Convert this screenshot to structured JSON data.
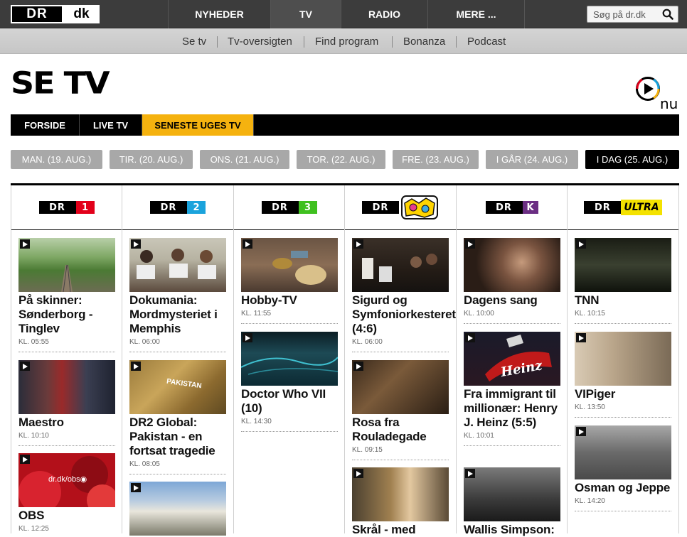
{
  "header": {
    "logo_dr": "DR",
    "logo_dk": "dk",
    "nav": [
      "NYHEDER",
      "TV",
      "RADIO",
      "MERE ..."
    ],
    "search_placeholder": "Søg på dr.dk"
  },
  "subnav": [
    "Se tv",
    "Tv-oversigten",
    "Find program",
    "Bonanza",
    "Podcast"
  ],
  "page": {
    "title": "SE TV",
    "nu_logo": "nu"
  },
  "tabs": [
    "FORSIDE",
    "LIVE TV",
    "SENESTE UGES TV"
  ],
  "days": [
    "MAN. (19. AUG.)",
    "TIR. (20. AUG.)",
    "ONS. (21. AUG.)",
    "TOR. (22. AUG.)",
    "FRE. (23. AUG.)",
    "I GÅR (24. AUG.)",
    "I DAG (25. AUG.)"
  ],
  "channels": [
    {
      "name": "DR",
      "badge": "1",
      "badge_color": "#e2001a",
      "programs": [
        {
          "title": "På skinner: Sønderborg - Tinglev",
          "time": "KL. 05:55"
        },
        {
          "title": "Maestro",
          "time": "KL. 10:10"
        },
        {
          "title": "OBS",
          "time": "KL. 12:25"
        }
      ]
    },
    {
      "name": "DR",
      "badge": "2",
      "badge_color": "#1aa3dc",
      "programs": [
        {
          "title": "Dokumania: Mordmysteriet i Memphis",
          "time": "KL. 06:00"
        },
        {
          "title": "DR2 Global: Pakistan - en fortsat tragedie",
          "time": "KL. 08:05"
        },
        {
          "title": "",
          "time": ""
        }
      ]
    },
    {
      "name": "DR",
      "badge": "3",
      "badge_color": "#3fc01f",
      "programs": [
        {
          "title": "Hobby-TV",
          "time": "KL. 11:55"
        },
        {
          "title": "Doctor Who VII (10)",
          "time": "KL. 14:30"
        }
      ]
    },
    {
      "name": "DR",
      "badge": "RAMASJANG",
      "badge_color": "#e83c8c",
      "programs": [
        {
          "title": "Sigurd og Symfoniorkesteret (4:6)",
          "time": "KL. 06:00"
        },
        {
          "title": "Rosa fra Rouladegade",
          "time": "KL. 09:15"
        },
        {
          "title": "Skrål - med",
          "time": ""
        }
      ]
    },
    {
      "name": "DR",
      "badge": "K",
      "badge_color": "#6b2e83",
      "programs": [
        {
          "title": "Dagens sang",
          "time": "KL. 10:00"
        },
        {
          "title": "Fra immigrant til millionær: Henry J. Heinz (5:5)",
          "time": "KL. 10:01"
        },
        {
          "title": "Wallis Simpson:",
          "time": ""
        }
      ]
    },
    {
      "name": "DR",
      "badge": "ULTRA",
      "badge_color": "#f4e200",
      "programs": [
        {
          "title": "TNN",
          "time": "KL. 10:15"
        },
        {
          "title": "VIPiger",
          "time": "KL. 13:50"
        },
        {
          "title": "Osman og Jeppe",
          "time": "KL. 14:20"
        }
      ]
    }
  ],
  "colors": {
    "accent": "#f5b20f",
    "topbar": "#3c3c3c",
    "day_inactive": "#a8a8a8",
    "day_active": "#000000"
  }
}
